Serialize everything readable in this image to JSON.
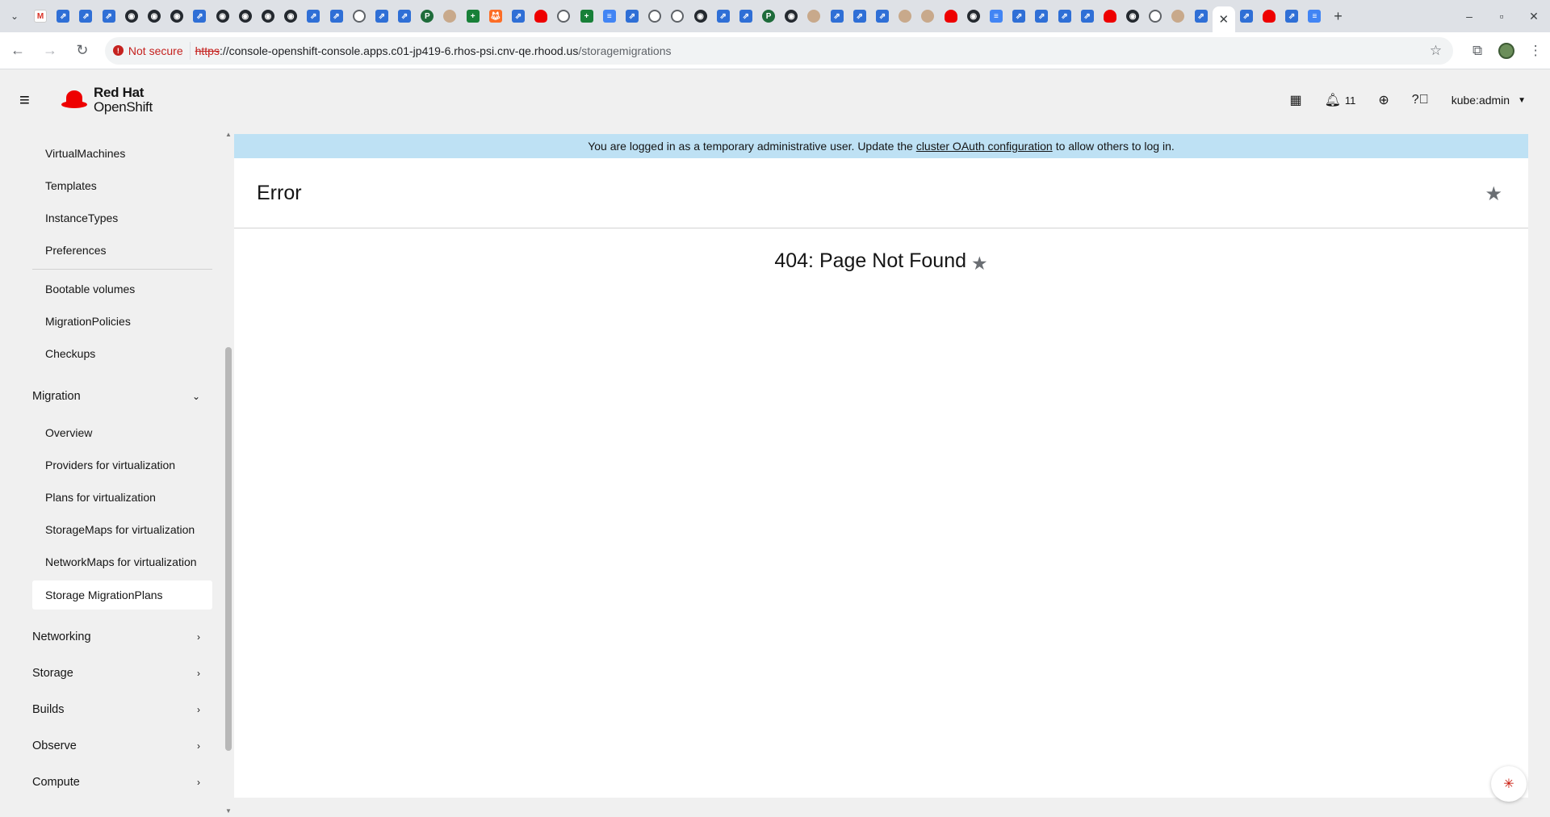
{
  "browser": {
    "tab_favicons": [
      "gmail",
      "jira",
      "jira",
      "jira",
      "github",
      "github",
      "github",
      "jira",
      "github",
      "github",
      "github",
      "github",
      "jira",
      "jira",
      "globe",
      "jira",
      "jira",
      "pr",
      "face",
      "green",
      "gitlab",
      "jira",
      "redhat",
      "globe",
      "green",
      "doc",
      "jira",
      "globe",
      "globe",
      "github",
      "jira",
      "jira",
      "pr",
      "github",
      "face",
      "jira",
      "jira",
      "jira",
      "face",
      "face",
      "redhat",
      "github",
      "doc",
      "jira",
      "jira",
      "jira",
      "jira",
      "redhat",
      "github",
      "globe",
      "face",
      "jira"
    ],
    "tab_favicons_after": [
      "jira",
      "redhat",
      "jira",
      "doc"
    ],
    "active_tab_close": "✕",
    "new_tab": "+",
    "security_label": "Not secure",
    "url_scheme": "https",
    "url_sep": "://",
    "url_host": "console-openshift-console.apps.c01-jp419-6.rhos-psi.cnv-qe.rhood.us",
    "url_path": "/storagemigrations"
  },
  "masthead": {
    "brand_line1": "Red Hat",
    "brand_line2": "OpenShift",
    "notifications_count": "11",
    "user": "kube:admin"
  },
  "sidebar": {
    "items_top": [
      "VirtualMachines",
      "Templates",
      "InstanceTypes",
      "Preferences"
    ],
    "items_mid": [
      "Bootable volumes",
      "MigrationPolicies",
      "Checkups"
    ],
    "migration_group": "Migration",
    "migration_items": [
      "Overview",
      "Providers for virtualization",
      "Plans for virtualization",
      "StorageMaps for virtualization",
      "NetworkMaps for virtualization"
    ],
    "active_item": "Storage MigrationPlans",
    "groups_bottom": [
      "Networking",
      "Storage",
      "Builds",
      "Observe",
      "Compute"
    ]
  },
  "banner": {
    "text_before": "You are logged in as a temporary administrative user. Update the",
    "link": "cluster OAuth configuration",
    "text_after": "to allow others to log in."
  },
  "page": {
    "title": "Error",
    "error_heading": "404: Page Not Found"
  }
}
